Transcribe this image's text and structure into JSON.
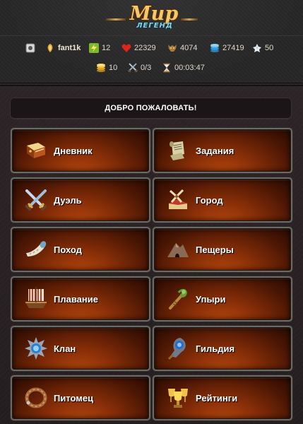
{
  "header": {
    "logo_main": "Мир",
    "logo_sub": "ЛЕГЕНД"
  },
  "stats": {
    "username": "fant1k",
    "level": "12",
    "health": "22329",
    "strength": "4074",
    "silver": "27419",
    "crystals": "50",
    "gold": "10",
    "battles": "0/3",
    "timer": "00:03:47"
  },
  "welcome": "ДОБРО ПОЖАЛОВАТЬ!",
  "menu": [
    {
      "label": "Дневник",
      "icon": "book-icon"
    },
    {
      "label": "Задания",
      "icon": "scroll-icon"
    },
    {
      "label": "Дуэль",
      "icon": "crossed-swords-icon"
    },
    {
      "label": "Город",
      "icon": "windmill-icon"
    },
    {
      "label": "Поход",
      "icon": "horn-icon"
    },
    {
      "label": "Пещеры",
      "icon": "mountain-icon"
    },
    {
      "label": "Плавание",
      "icon": "ship-icon"
    },
    {
      "label": "Упыри",
      "icon": "staff-icon"
    },
    {
      "label": "Клан",
      "icon": "clan-emblem-icon"
    },
    {
      "label": "Гильдия",
      "icon": "guild-emblem-icon"
    },
    {
      "label": "Питомец",
      "icon": "collar-icon"
    },
    {
      "label": "Рейтинги",
      "icon": "trophy-icon"
    }
  ],
  "colors": {
    "accent_gold": "#f2c869",
    "button_glow": "#b5480e",
    "background": "#2b2426"
  }
}
